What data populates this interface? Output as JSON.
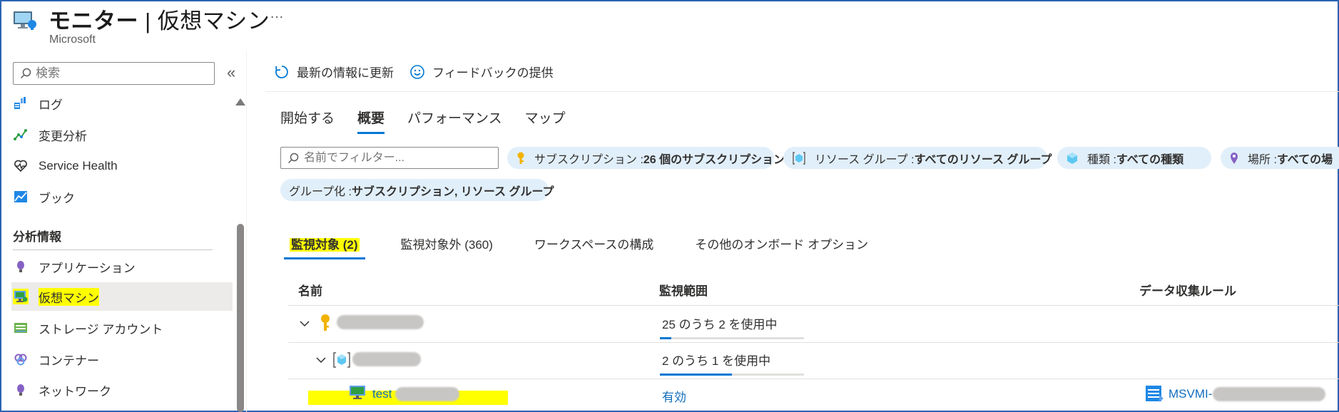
{
  "header": {
    "title_bold": "モニター",
    "title_sep": " | ",
    "title_rest": "仮想マシン",
    "more": "…",
    "subtitle": "Microsoft"
  },
  "sidebar": {
    "search_placeholder": "検索",
    "collapse": "«",
    "items": [
      {
        "label": "ログ",
        "icon": "log-icon"
      },
      {
        "label": "変更分析",
        "icon": "change-analysis-icon"
      },
      {
        "label": "Service Health",
        "icon": "heart-icon"
      },
      {
        "label": "ブック",
        "icon": "workbook-icon"
      }
    ],
    "section_title": "分析情報",
    "insights": [
      {
        "label": "アプリケーション",
        "icon": "lightbulb-icon"
      },
      {
        "label": "仮想マシン",
        "icon": "virtual-machine-icon",
        "selected": true
      },
      {
        "label": "ストレージ アカウント",
        "icon": "storage-icon"
      },
      {
        "label": "コンテナー",
        "icon": "container-icon"
      },
      {
        "label": "ネットワーク",
        "icon": "lightbulb-icon"
      }
    ]
  },
  "toolbar": {
    "refresh": "最新の情報に更新",
    "feedback": "フィードバックの提供"
  },
  "tabs": {
    "items": [
      "開始する",
      "概要",
      "パフォーマンス",
      "マップ"
    ],
    "active": "概要"
  },
  "filters": {
    "name_placeholder": "名前でフィルター...",
    "subscription_label": "サブスクリプション : ",
    "subscription_value": "26 個のサブスクリプション",
    "resource_group_label": "リソース グループ : ",
    "resource_group_value": "すべてのリソース グループ",
    "type_label": "種類 : ",
    "type_value": "すべての種類",
    "location_label": "場所 : ",
    "location_value": "すべての場",
    "group_by_label": "グループ化 : ",
    "group_by_value": "サブスクリプション, リソース グループ"
  },
  "subtabs": {
    "monitored": "監視対象 (2)",
    "unmonitored": "監視対象外 (360)",
    "workspace": "ワークスペースの構成",
    "other": "その他のオンボード オプション"
  },
  "table": {
    "col_name": "名前",
    "col_coverage": "監視範囲",
    "col_dcr": "データ収集ルール",
    "rows": [
      {
        "coverage": "25 のうち 2 を使用中",
        "progress": 0.08
      },
      {
        "coverage": "2 のうち 1 を使用中",
        "progress": 0.5
      },
      {
        "name": "test",
        "coverage": "有効",
        "dcr": "MSVMI-"
      }
    ]
  }
}
